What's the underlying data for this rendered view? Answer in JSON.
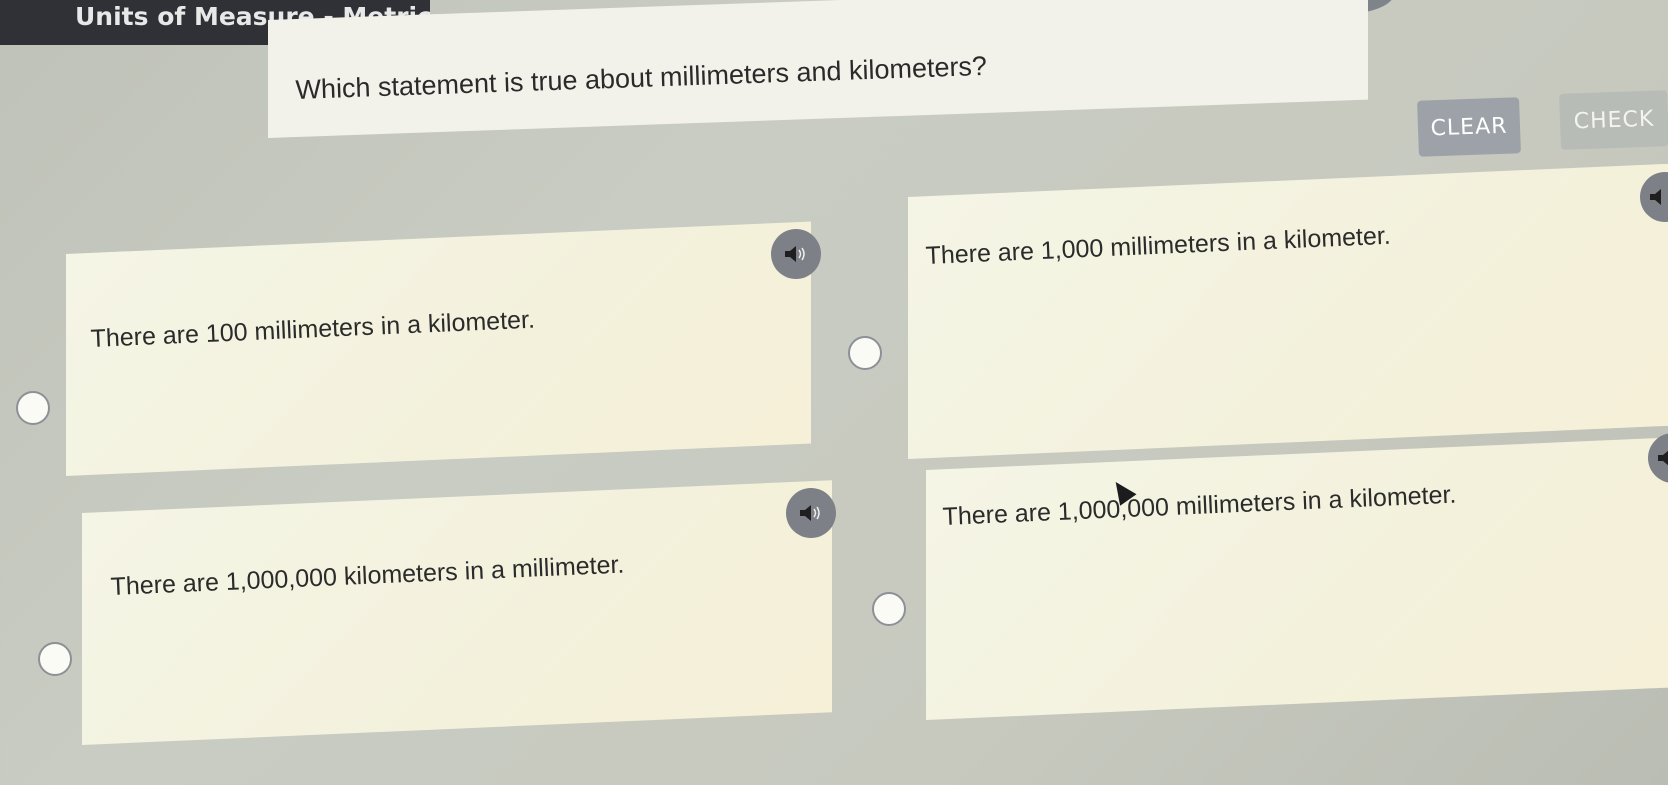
{
  "header": {
    "title": "Units of Measure - Metric"
  },
  "question": {
    "text": "Which statement is true about millimeters and kilometers?"
  },
  "actions": {
    "clear_label": "CLEAR",
    "check_label": "CHECK"
  },
  "options": [
    {
      "text": "There are 100 millimeters in a kilometer."
    },
    {
      "text": "There are 1,000 millimeters in a kilometer."
    },
    {
      "text": "There are 1,000,000 kilometers in a millimeter."
    },
    {
      "text": "There are 1,000,000 millimeters in a kilometer."
    }
  ],
  "icons": {
    "audio": "speaker-icon",
    "radio": "radio-button"
  },
  "colors": {
    "header_bg": "#2f3136",
    "button_bg": "#9ca2a8",
    "card_bg": "#f3f1dc",
    "audio_bg": "#7d8187"
  }
}
